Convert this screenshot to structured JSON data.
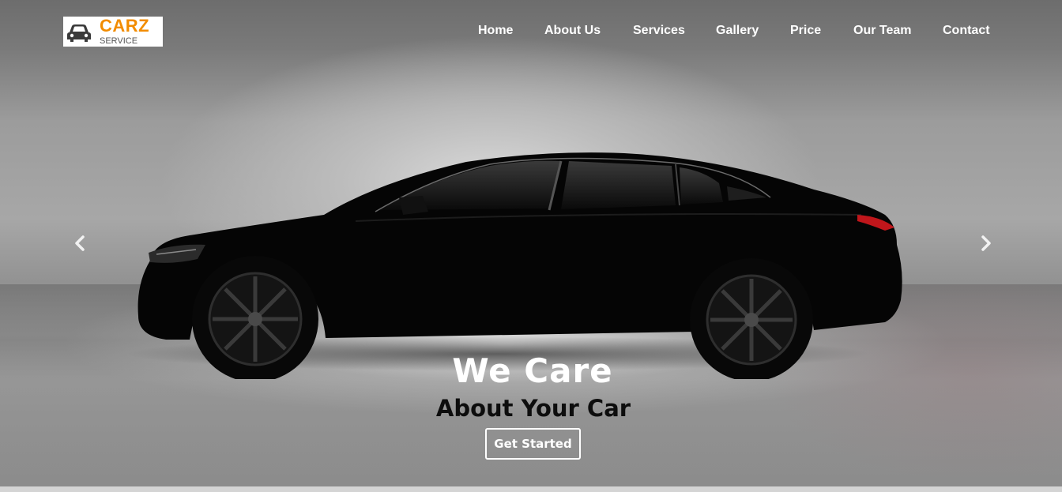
{
  "logo": {
    "title": "CARZ",
    "subtitle": "SERVICE",
    "icon": "car-icon"
  },
  "nav": {
    "items": [
      {
        "label": "Home"
      },
      {
        "label": "About Us"
      },
      {
        "label": "Services"
      },
      {
        "label": "Gallery"
      },
      {
        "label": "Price"
      },
      {
        "label": "Our Team"
      },
      {
        "label": "Contact"
      }
    ]
  },
  "hero": {
    "title": "We Care",
    "subtitle": "About Your Car",
    "cta_label": "Get Started",
    "prev_icon": "chevron-left-icon",
    "next_icon": "chevron-right-icon"
  },
  "colors": {
    "brand_accent": "#f28c00",
    "nav_text": "#ffffff",
    "car_body": "#050505",
    "tail_light": "#c0161b"
  }
}
